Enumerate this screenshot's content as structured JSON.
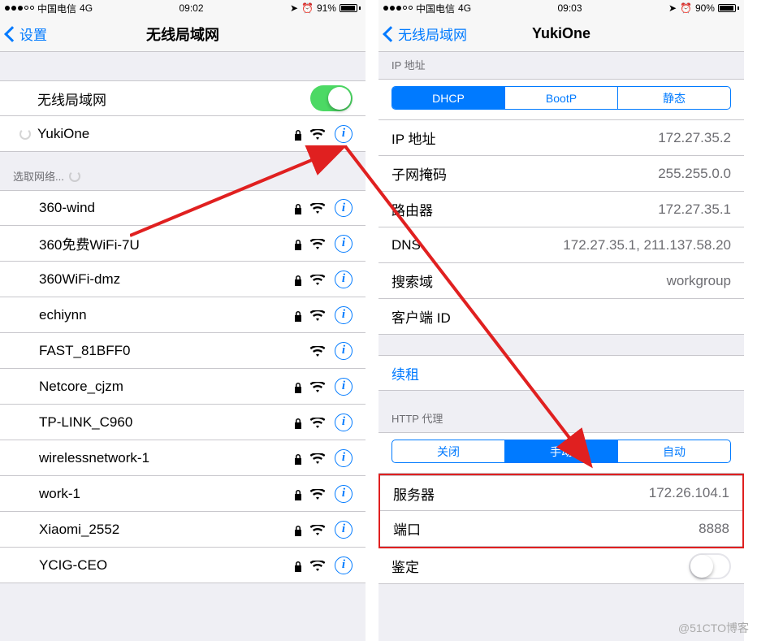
{
  "left": {
    "statusbar": {
      "carrier": "中国电信",
      "network": "4G",
      "time": "09:02",
      "battery": "91%"
    },
    "nav": {
      "back": "设置",
      "title": "无线局域网"
    },
    "wifi_label": "无线局域网",
    "connected_network": "YukiOne",
    "choose_network": "选取网络...",
    "networks": [
      {
        "name": "360-wind",
        "locked": true
      },
      {
        "name": "360免费WiFi-7U",
        "locked": true
      },
      {
        "name": "360WiFi-dmz",
        "locked": true
      },
      {
        "name": "echiynn",
        "locked": true
      },
      {
        "name": "FAST_81BFF0",
        "locked": false
      },
      {
        "name": "Netcore_cjzm",
        "locked": true
      },
      {
        "name": "TP-LINK_C960",
        "locked": true
      },
      {
        "name": "wirelessnetwork-1",
        "locked": true
      },
      {
        "name": "work-1",
        "locked": true
      },
      {
        "name": "Xiaomi_2552",
        "locked": true
      },
      {
        "name": "YCIG-CEO",
        "locked": true
      }
    ]
  },
  "right": {
    "statusbar": {
      "carrier": "中国电信",
      "network": "4G",
      "time": "09:03",
      "battery": "90%"
    },
    "nav": {
      "back": "无线局域网",
      "title": "YukiOne"
    },
    "ip_section_header": "IP 地址",
    "ip_tabs": {
      "dhcp": "DHCP",
      "bootp": "BootP",
      "static": "静态"
    },
    "ip_rows": {
      "ip_label": "IP 地址",
      "ip_value": "172.27.35.2",
      "mask_label": "子网掩码",
      "mask_value": "255.255.0.0",
      "router_label": "路由器",
      "router_value": "172.27.35.1",
      "dns_label": "DNS",
      "dns_value": "172.27.35.1, 211.137.58.20",
      "search_label": "搜索域",
      "search_value": "workgroup",
      "clientid_label": "客户端 ID",
      "clientid_value": ""
    },
    "renew": "续租",
    "proxy_header": "HTTP 代理",
    "proxy_tabs": {
      "off": "关闭",
      "manual": "手动",
      "auto": "自动"
    },
    "proxy_rows": {
      "server_label": "服务器",
      "server_value": "172.26.104.1",
      "port_label": "端口",
      "port_value": "8888",
      "auth_label": "鉴定"
    }
  },
  "watermark": "@51CTO博客"
}
